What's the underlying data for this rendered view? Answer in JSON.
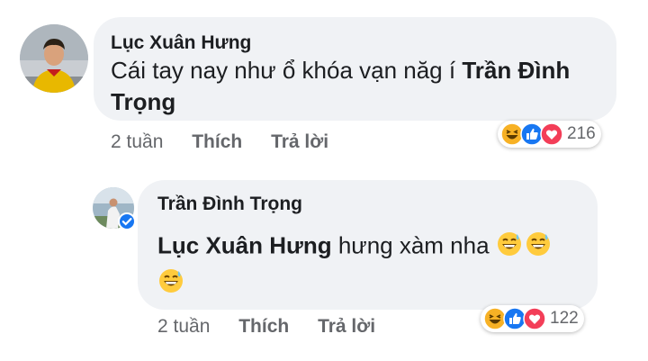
{
  "comments": [
    {
      "author": "Lục Xuân Hưng",
      "text_line1_prefix": "Cái tay nay như ổ khóa vạn năg í ",
      "mention_part1": "Trần Đình",
      "mention_part2": "Trọng",
      "time": "2 tuần",
      "like_label": "Thích",
      "reply_label": "Trả lời",
      "reaction_icons": [
        "haha-icon",
        "like-icon",
        "love-icon"
      ],
      "reaction_count": "216"
    },
    {
      "author": "Trần Đình Trọng",
      "mention": "Lục Xuân Hưng",
      "text_suffix": " hưng xàm nha ",
      "emojis": [
        "grinning-sweat-emoji",
        "grinning-sweat-emoji",
        "grinning-sweat-emoji"
      ],
      "time": "2 tuần",
      "like_label": "Thích",
      "reply_label": "Trả lời",
      "reaction_icons": [
        "haha-icon",
        "like-icon",
        "love-icon"
      ],
      "reaction_count": "122",
      "verified_badge": "verified-icon"
    }
  ],
  "colors": {
    "bubble": "#f0f2f5",
    "meta_text": "#65676b",
    "like_blue": "#1877f2",
    "love_red": "#f33e58",
    "haha_yellow": "#f7b125"
  }
}
